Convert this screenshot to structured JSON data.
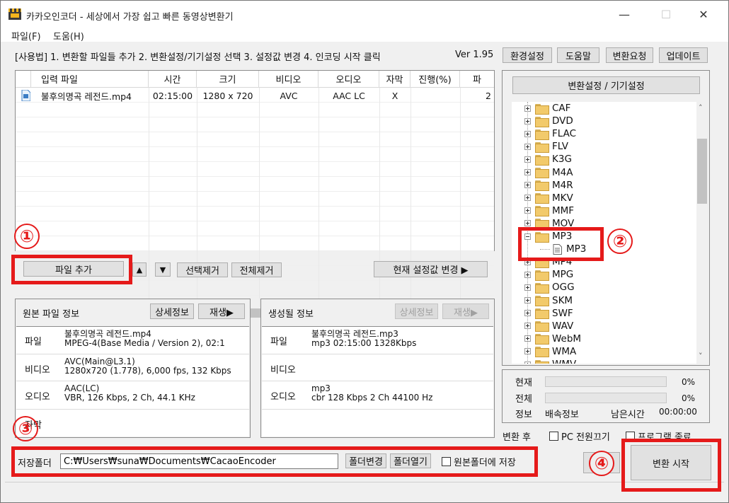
{
  "window": {
    "title": "카카오인코더 - 세상에서 가장 쉽고 빠른 동영상변환기",
    "minimize_glyph": "—",
    "maximize_glyph": "☐",
    "close_glyph": "✕"
  },
  "menu": {
    "file": "파일(F)",
    "help": "도움(H)"
  },
  "toolbar": {
    "instructions": "[사용법] 1. 변환할 파일들 추가  2. 변환설정/기기설정 선택  3. 설정값 변경  4. 인코딩 시작 클릭",
    "version": "Ver 1.95",
    "settings": "환경설정",
    "help": "도움말",
    "request": "변환요청",
    "update": "업데이트"
  },
  "file_table": {
    "columns": [
      "입력 파일",
      "시간",
      "크기",
      "비디오",
      "오디오",
      "자막",
      "진행(%)",
      "파"
    ],
    "rows": [
      {
        "name": "불후의명곡 레전드.mp4",
        "time": "02:15:00",
        "size": "1280 x 720",
        "video": "AVC",
        "audio": "AAC LC",
        "subtitle": "X",
        "progress": "",
        "extra": "2"
      }
    ]
  },
  "file_buttons": {
    "add_file": "파일 추가",
    "move_up": "▲",
    "move_down": "▼",
    "remove_selected": "선택제거",
    "remove_all": "전체제거",
    "change_current": "현재 설정값 변경 ▶"
  },
  "source_info": {
    "title": "원본 파일 정보",
    "detail_button": "상세정보",
    "play_button": "재생▶",
    "file_label": "파일",
    "file_line1": "불후의명곡 레전드.mp4",
    "file_line2": "MPEG-4(Base Media / Version 2), 02:1",
    "video_label": "비디오",
    "video_line1": "AVC(Main@L3.1)",
    "video_line2": "1280x720 (1.778), 6,000 fps, 132 Kbps",
    "audio_label": "오디오",
    "audio_line1": "AAC(LC)",
    "audio_line2": "VBR, 126 Kbps, 2 Ch, 44.1 KHz",
    "subtitle_label": "자막"
  },
  "output_info": {
    "title": "생성될 정보",
    "detail_button": "상세정보",
    "play_button": "재생▶",
    "file_label": "파일",
    "file_line1": "불후의명곡 레전드.mp3",
    "file_line2": "mp3  02:15:00  1328Kbps",
    "video_label": "비디오",
    "audio_label": "오디오",
    "audio_line1": "mp3",
    "audio_line2": "cbr    128 Kbps  2 Ch  44100 Hz"
  },
  "save_folder": {
    "label": "저장폴더",
    "path": "C:₩Users₩suna₩Documents₩CacaoEncoder",
    "change_button": "폴더변경",
    "open_button": "폴더열기",
    "same_folder_label": "원본폴더에 저장"
  },
  "conversion_settings": {
    "header_button": "변환설정 / 기기설정",
    "tree": [
      {
        "label": "CAF",
        "expanded": false
      },
      {
        "label": "DVD",
        "expanded": false
      },
      {
        "label": "FLAC",
        "expanded": false
      },
      {
        "label": "FLV",
        "expanded": false
      },
      {
        "label": "K3G",
        "expanded": false
      },
      {
        "label": "M4A",
        "expanded": false
      },
      {
        "label": "M4R",
        "expanded": false
      },
      {
        "label": "MKV",
        "expanded": false
      },
      {
        "label": "MMF",
        "expanded": false
      },
      {
        "label": "MOV",
        "expanded": false
      },
      {
        "label": "MP3",
        "expanded": true
      },
      {
        "label": "MP3",
        "child": true
      },
      {
        "label": "MP4",
        "expanded": false
      },
      {
        "label": "MPG",
        "expanded": false
      },
      {
        "label": "OGG",
        "expanded": false
      },
      {
        "label": "SKM",
        "expanded": false
      },
      {
        "label": "SWF",
        "expanded": false
      },
      {
        "label": "WAV",
        "expanded": false
      },
      {
        "label": "WebM",
        "expanded": false
      },
      {
        "label": "WMA",
        "expanded": false
      },
      {
        "label": "WMV",
        "expanded": false
      }
    ]
  },
  "status": {
    "current_label": "현재",
    "current_percent": "0%",
    "current_progress": 0,
    "total_label": "전체",
    "total_percent": "0%",
    "total_progress": 0,
    "info_label": "정보",
    "speed_label": "배속정보",
    "remaining_label": "남은시간",
    "remaining_time": "00:00:00"
  },
  "after_conversion": {
    "label": "변환 후",
    "pc_off": "PC 전원끄기",
    "program_exit": "프로그램 종료"
  },
  "actions": {
    "test": "테스트",
    "start": "변환 시작"
  },
  "callouts": [
    "①",
    "②",
    "③",
    "④"
  ],
  "colors": {
    "highlight": "#e51a1a"
  }
}
